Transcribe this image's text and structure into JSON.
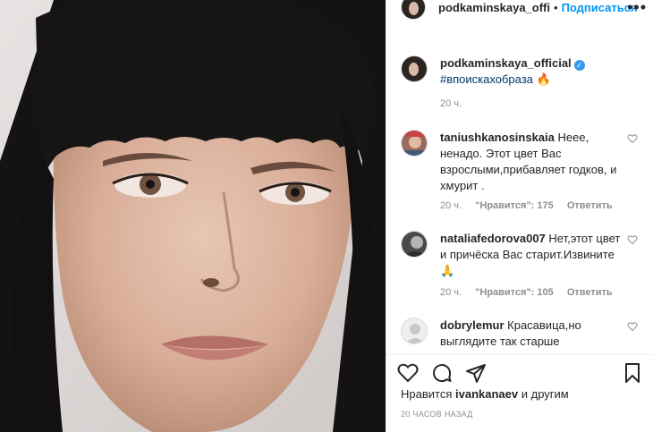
{
  "post": {
    "photo_alt": "portrait photo"
  },
  "header": {
    "username": "podkaminskaya_offi",
    "separator": "•",
    "follow_label": "Подписаться",
    "more_label": "•••"
  },
  "caption": {
    "username": "podkaminskaya_official",
    "verified_mark": "✓",
    "hashtag": "#впоискахобраза",
    "emoji": "🔥",
    "time": "20 ч."
  },
  "comments": [
    {
      "username": "taniushkanosinskaia",
      "text": "Неее, ненадо. Этот цвет Вас взрослыми,прибавляет годков, и хмурит .",
      "time": "20 ч.",
      "likes": "\"Нравится\": 175",
      "reply": "Ответить"
    },
    {
      "username": "nataliafedorova007",
      "text": "Нет,этот цвет и причёска Вас старит.Извините🙏",
      "time": "20 ч.",
      "likes": "\"Нравится\": 105",
      "reply": "Ответить"
    },
    {
      "username": "dobrylemur",
      "text": "Красавица,но выглядите так старше",
      "time": "",
      "likes": "",
      "reply": ""
    }
  ],
  "actions": {
    "like_icon": "heart-icon",
    "comment_icon": "comment-icon",
    "share_icon": "paper-plane-icon",
    "save_icon": "bookmark-icon"
  },
  "likes": {
    "prefix": "Нравится",
    "user": "ivankanaev",
    "suffix": "и другим"
  },
  "post_time": "20 ЧАСОВ НАЗАД",
  "colors": {
    "link_blue": "#0095f6",
    "hashtag": "#00376b",
    "muted": "#8e8e8e",
    "verified": "#3897f0"
  }
}
